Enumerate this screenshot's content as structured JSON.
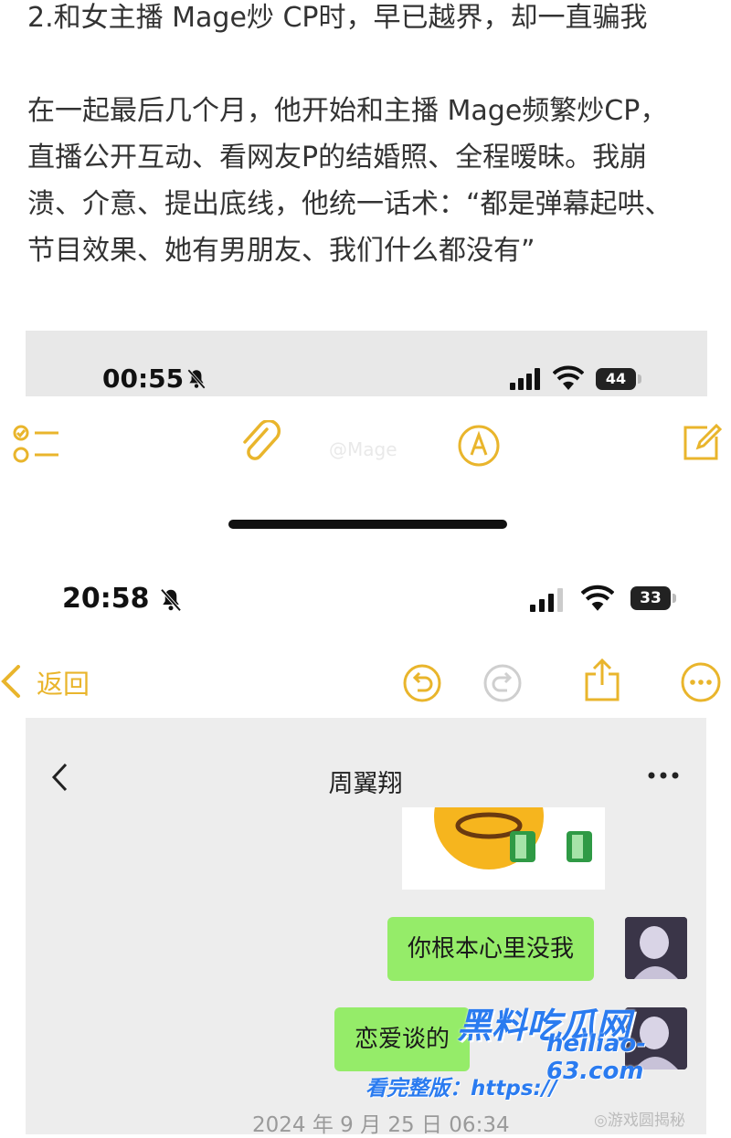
{
  "article": {
    "headline": "2.和女主播 Mage炒 CP时，早已越界，却一直骗我",
    "paragraph": "在一起最后几个月，他开始和主播 Mage频繁炒CP，直播公开互动、看网友P的结婚照、全程暧昧。我崩溃、介意、提出底线，他统一话术：“都是弹幕起哄、节目效果、她有男朋友、我们什么都没有”"
  },
  "screenshot1": {
    "time": "00:55",
    "battery": "44",
    "faint_text": "@Mage"
  },
  "screenshot2": {
    "time": "20:58",
    "battery": "33",
    "back_label": "返回"
  },
  "chat": {
    "contact_name": "周翼翔",
    "messages": [
      "你根本心里没我",
      "恋爱谈的"
    ],
    "date": "2024 年 9 月 25 日 06:34"
  },
  "watermark": {
    "site": "黑料吃瓜网",
    "prefix": "看完整版：",
    "url_part1": "https://",
    "url_part2": "heiliao-63.com",
    "credit": "◎游戏圆揭秘"
  },
  "colors": {
    "notes_yellow": "#e9b52c",
    "chat_bubble": "#95ec69",
    "watermark_blue": "#2a7bf0"
  }
}
